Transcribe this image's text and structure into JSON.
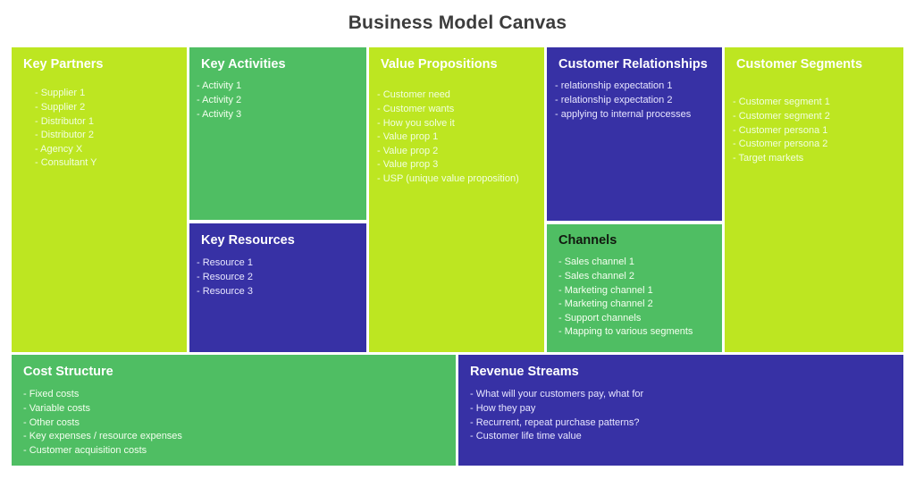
{
  "page": {
    "title": "Business Model Canvas"
  },
  "blocks": {
    "key_partners": {
      "heading": "Key Partners",
      "items": [
        "- Supplier 1",
        "- Supplier 2",
        "- Distributor 1",
        "- Distributor 2",
        "- Agency X",
        "- Consultant Y"
      ]
    },
    "key_activities": {
      "heading": "Key Activities",
      "items": [
        "- Activity 1",
        "- Activity 2",
        "- Activity 3"
      ]
    },
    "key_resources": {
      "heading": "Key Resources",
      "items": [
        "- Resource 1",
        "- Resource 2",
        "- Resource 3"
      ]
    },
    "value_propositions": {
      "heading": "Value Propositions",
      "items": [
        "- Customer need",
        "- Customer wants",
        "- How you solve it",
        "- Value prop 1",
        "- Value prop 2",
        "- Value prop 3",
        "- USP (unique value proposition)"
      ]
    },
    "customer_relationships": {
      "heading": "Customer Relationships",
      "items": [
        "- relationship expectation 1",
        "- relationship expectation 2",
        "- applying to internal processes"
      ]
    },
    "channels": {
      "heading": "Channels",
      "items": [
        "- Sales channel 1",
        "- Sales channel 2",
        "- Marketing channel 1",
        "- Marketing channel 2",
        "- Support channels",
        "- Mapping to various segments"
      ]
    },
    "customer_segments": {
      "heading": "Customer Segments",
      "items": [
        "- Customer segment 1",
        "- Customer segment 2",
        "- Customer persona 1",
        "- Customer persona 2",
        "- Target markets"
      ]
    },
    "cost_structure": {
      "heading": "Cost Structure",
      "items": [
        "- Fixed costs",
        "- Variable costs",
        "- Other costs",
        "- Key expenses / resource expenses",
        "- Customer acquisition costs"
      ]
    },
    "revenue_streams": {
      "heading": "Revenue Streams",
      "items": [
        "- What will your customers pay, what for",
        "- How they pay",
        "- Recurrent, repeat purchase patterns?",
        "- Customer life time value"
      ]
    }
  },
  "colors": {
    "lime": "#bde621",
    "green": "#4fbe63",
    "blue": "#3731a5",
    "title_text": "#3c3c3c",
    "page_background": "#ffffff"
  }
}
